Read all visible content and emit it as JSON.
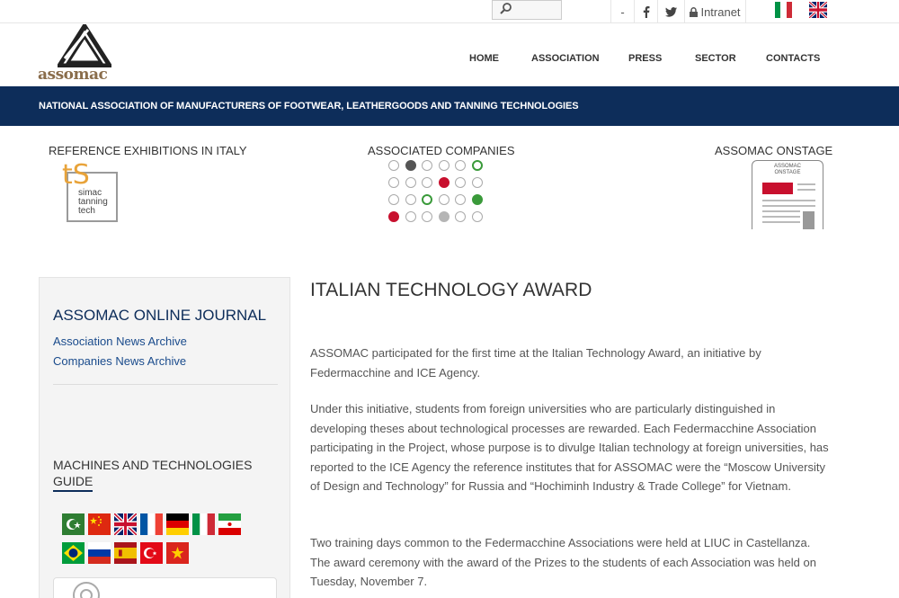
{
  "topbar": {
    "dash": "-",
    "intranet_label": "Intranet",
    "search_placeholder": ""
  },
  "logo": {
    "text": "assomac"
  },
  "nav": {
    "items": [
      {
        "label": "HOME"
      },
      {
        "label": "ASSOCIATION"
      },
      {
        "label": "PRESS"
      },
      {
        "label": "SECTOR"
      },
      {
        "label": "CONTACTS"
      }
    ]
  },
  "banner": {
    "text": "NATIONAL ASSOCIATION OF MANUFACTURERS OF FOOTWEAR, LEATHERGOODS AND TANNING TECHNOLOGIES"
  },
  "blocks": {
    "exhibitions_title": "REFERENCE EXHIBITIONS IN ITALY",
    "ts_letters": "tS",
    "ts_line1": "simac",
    "ts_line2": "tanning",
    "ts_line3": "tech",
    "associated_title": "ASSOCIATED COMPANIES",
    "onstage_title": "ASSOMAC ONSTAGE",
    "onstage_cover_line1": "ASSOMAC",
    "onstage_cover_line2": "ONSTAGE"
  },
  "sidebar": {
    "journal_title": "ASSOMAC ONLINE JOURNAL",
    "links": [
      "Association News Archive",
      "Companies News Archive"
    ],
    "guide_title_line1": "MACHINES AND TECHNOLOGIES",
    "guide_title_line2": "GUIDE",
    "flags": [
      "arabic",
      "chinese",
      "english",
      "french",
      "german",
      "italian",
      "persian",
      "portuguese-brazil",
      "russian",
      "spanish",
      "turkish",
      "vietnamese"
    ]
  },
  "article": {
    "title": "ITALIAN TECHNOLOGY AWARD",
    "paragraphs": [
      "ASSOMAC participated for the first time at the Italian Technology Award, an initiative by Federmacchine and ICE Agency.",
      "Under this initiative, students from foreign universities who are particularly distinguished in developing theses about technological processes are rewarded. Each Federmacchine Association participating in the Project, whose purpose is to divulge Italian technology at foreign universities, has reported to the ICE Agency the reference institutes that for ASSOMAC were the “Moscow University of Design and Technology” for Russia and “Hochiminh Industry & Trade College” for Vietnam.",
      "Two training days common to the Federmacchine Associations were held at LIUC in Castellanza. The award ceremony with the award of the Prizes to the students of each Association was held on Tuesday, November 7."
    ]
  },
  "colors": {
    "navy": "#0d2d5a",
    "link_blue": "#1a4b8c",
    "dot_green": "#3a9a3a",
    "dot_red": "#c8102e",
    "dot_dark": "#555555",
    "dot_gray": "#b5b5b5"
  }
}
